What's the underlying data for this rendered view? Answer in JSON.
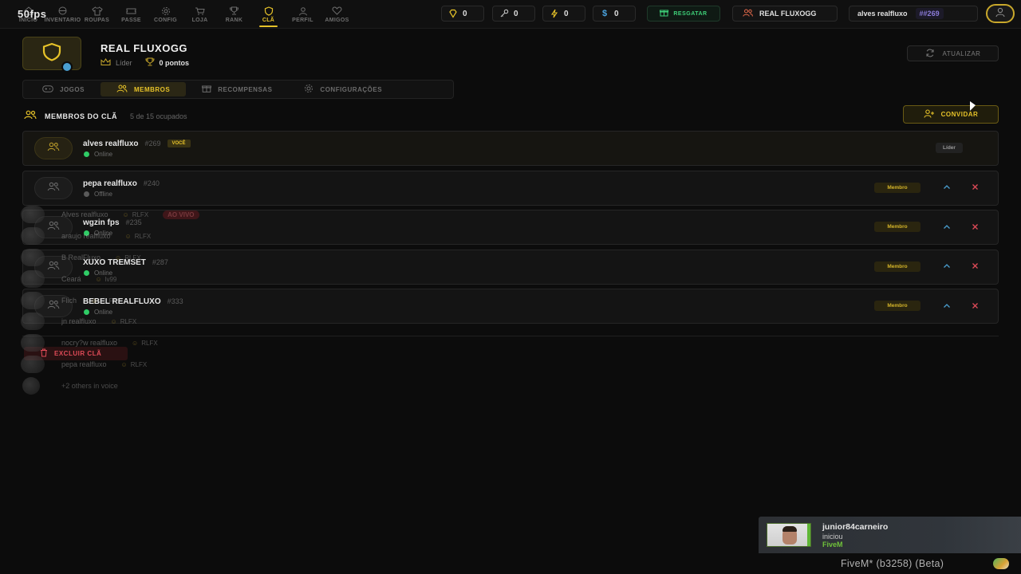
{
  "fps": "50fps",
  "nav": [
    {
      "label": "INICIO",
      "icon": "home-icon"
    },
    {
      "label": "INVENTARIO",
      "icon": "inventory-icon"
    },
    {
      "label": "ROUPAS",
      "icon": "shirt-icon"
    },
    {
      "label": "PASSE",
      "icon": "ticket-icon"
    },
    {
      "label": "CONFIG",
      "icon": "gear-icon"
    },
    {
      "label": "LOJA",
      "icon": "cart-icon"
    },
    {
      "label": "RANK",
      "icon": "trophy-icon"
    },
    {
      "label": "CLÃ",
      "icon": "shield-icon",
      "active": true
    },
    {
      "label": "PERFIL",
      "icon": "user-icon"
    },
    {
      "label": "AMIGOS",
      "icon": "heart-icon"
    }
  ],
  "currencies": [
    {
      "icon": "gem-icon",
      "value": "0",
      "color": "#e6c229"
    },
    {
      "icon": "key-icon",
      "value": "0",
      "color": "#bfbfbf"
    },
    {
      "icon": "bolt-icon",
      "value": "0",
      "color": "#e6c229"
    },
    {
      "icon": "dollar-icon",
      "value": "0",
      "color": "#4aa3df"
    }
  ],
  "header": {
    "resgatar": "RESGATAR",
    "clan_pill": "REAL FLUXOGG",
    "user_name": "alves realfluxo",
    "user_tag": "##269"
  },
  "clan": {
    "name": "REAL FLUXOGG",
    "role": "Líder",
    "points": "0 pontos",
    "refresh_label": "ATUALIZAR"
  },
  "tabs": [
    {
      "label": "JOGOS",
      "icon": "gamepad-icon"
    },
    {
      "label": "MEMBROS",
      "icon": "users-icon",
      "active": true
    },
    {
      "label": "RECOMPENSAS",
      "icon": "gift-icon"
    },
    {
      "label": "CONFIGURAÇÕES",
      "icon": "gear-icon"
    }
  ],
  "members_section": {
    "title": "MEMBROS DO CLÃ",
    "count": "5 de 15 ocupados",
    "invite_label": "CONVIDAR"
  },
  "members": [
    {
      "name": "alves realfluxo",
      "tag": "#269",
      "badge": "VOCÊ",
      "status": "Online",
      "role": "Líder"
    },
    {
      "name": "pepa realfluxo",
      "tag": "#240",
      "status": "Offline",
      "role": "Membro"
    },
    {
      "name": "wgzin fps",
      "tag": "#235",
      "status": "Online",
      "role": "Membro"
    },
    {
      "name": "XUXO TREMSET",
      "tag": "#287",
      "status": "Online",
      "role": "Membro"
    },
    {
      "name": "BEBEL REALFLUXO",
      "tag": "#333",
      "status": "Online",
      "role": "Membro"
    }
  ],
  "delete_label": "EXCLUIR CLÃ",
  "voice_overlay": [
    {
      "name": "Alves realfluxo",
      "tag": "RLFX",
      "live": "AO VIVO"
    },
    {
      "name": "araujo realfluxo",
      "tag": "RLFX"
    },
    {
      "name": "B RealFluxo",
      "tag": "RLFX"
    },
    {
      "name": "Ceará",
      "tag": "lv99"
    },
    {
      "name": "Flich",
      "tag": "RLFX"
    },
    {
      "name": "jn realfluxo",
      "tag": "RLFX"
    },
    {
      "name": "nocry?w realfluxo",
      "tag": "RLFX"
    },
    {
      "name": "pepa realfluxo",
      "tag": "RLFX"
    },
    {
      "name": "+2 others in voice"
    }
  ],
  "notification": {
    "user": "junior84carneiro",
    "action": "iniciou",
    "game": "FiveM"
  },
  "build": "FiveM* (b3258) (Beta)"
}
